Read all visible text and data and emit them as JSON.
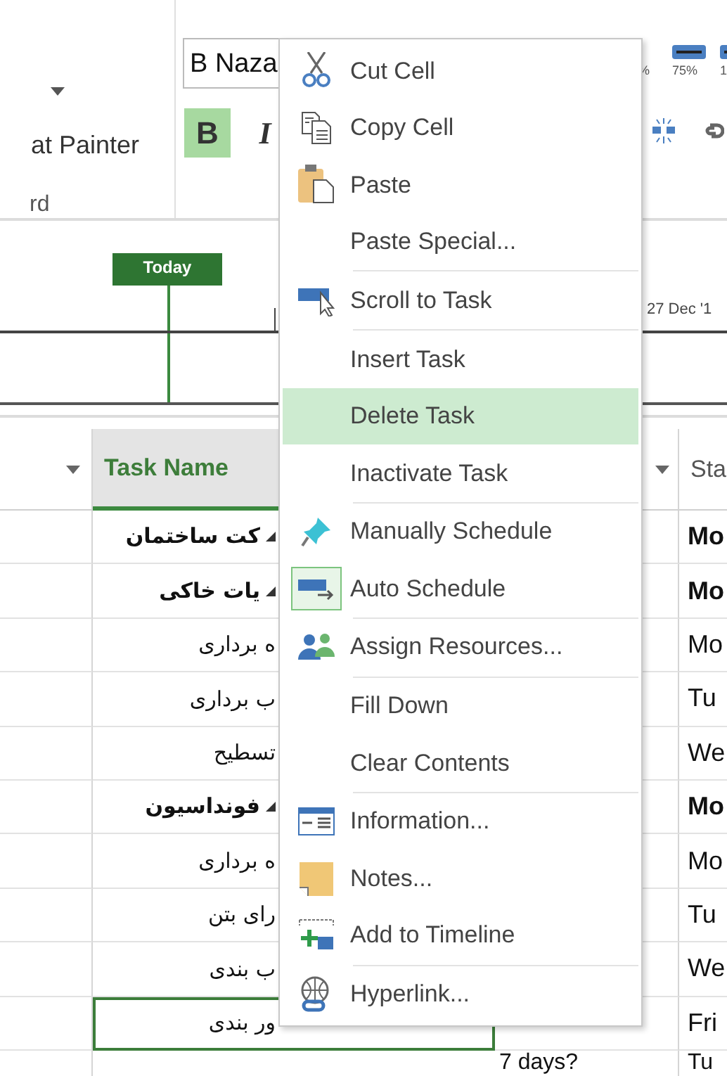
{
  "ribbon": {
    "clipboard": {
      "format_painter": "at Painter",
      "group_label": "rd"
    },
    "font": {
      "font_name": "B Naza",
      "bold": {
        "label": "B",
        "on": true
      },
      "italic": {
        "label": "I",
        "on": false
      }
    },
    "zoom": {
      "percent_labels": [
        "%",
        "75%",
        "1"
      ]
    }
  },
  "timeline": {
    "today_label": "Today",
    "date_label": "27 Dec '1"
  },
  "table": {
    "columns": [
      {
        "title": "Task Name",
        "selected": true
      },
      {
        "title": "Sta",
        "selected": false
      }
    ],
    "rows": [
      {
        "name": "کت ساختمان",
        "summary": true,
        "expanded": true,
        "start": "Mo",
        "selected": false,
        "children": [
          {
            "name": "یات خاکی",
            "summary": true,
            "expanded": true,
            "start": "Mo",
            "selected": false,
            "children": [
              {
                "name": "ه برداری",
                "summary": false,
                "start": "Mo",
                "selected": false
              },
              {
                "name": "ب برداری",
                "summary": false,
                "start": "Tu",
                "selected": false
              },
              {
                "name": "تسطیح",
                "summary": false,
                "start": "We",
                "selected": false
              }
            ]
          },
          {
            "name": "فونداسیون",
            "summary": true,
            "expanded": true,
            "start": "Mo",
            "selected": false,
            "children": [
              {
                "name": "ه برداری",
                "summary": false,
                "start": "Mo",
                "selected": false
              },
              {
                "name": "رای بتن",
                "summary": false,
                "start": "Tu",
                "selected": false
              },
              {
                "name": "ب بندی",
                "summary": false,
                "start": "We",
                "selected": false
              },
              {
                "name": "ور بندی",
                "summary": false,
                "start": "Fri",
                "selected": true
              }
            ]
          }
        ]
      }
    ],
    "partial_row": {
      "duration": "7 days?",
      "start": "Tu"
    }
  },
  "context_menu": {
    "groups": [
      [
        {
          "label": "Cut Cell",
          "highlighted": false,
          "checked": false
        },
        {
          "label": "Copy Cell",
          "highlighted": false,
          "checked": false
        },
        {
          "label": "Paste",
          "highlighted": false,
          "checked": false
        },
        {
          "label": "Paste Special...",
          "highlighted": false,
          "checked": false
        }
      ],
      [
        {
          "label": "Scroll to Task",
          "highlighted": false,
          "checked": false
        }
      ],
      [
        {
          "label": "Insert Task",
          "highlighted": false,
          "checked": false
        },
        {
          "label": "Delete Task",
          "highlighted": true,
          "checked": false
        },
        {
          "label": "Inactivate Task",
          "highlighted": false,
          "checked": false
        }
      ],
      [
        {
          "label": "Manually Schedule",
          "highlighted": false,
          "checked": false
        },
        {
          "label": "Auto Schedule",
          "highlighted": false,
          "checked": true
        }
      ],
      [
        {
          "label": "Assign Resources...",
          "highlighted": false,
          "checked": false
        }
      ],
      [
        {
          "label": "Fill Down",
          "highlighted": false,
          "checked": false
        },
        {
          "label": "Clear Contents",
          "highlighted": false,
          "checked": false
        }
      ],
      [
        {
          "label": "Information...",
          "highlighted": false,
          "checked": false
        },
        {
          "label": "Notes...",
          "highlighted": false,
          "checked": false
        },
        {
          "label": "Add to Timeline",
          "highlighted": false,
          "checked": false
        }
      ],
      [
        {
          "label": "Hyperlink...",
          "highlighted": false,
          "checked": false
        }
      ]
    ]
  }
}
